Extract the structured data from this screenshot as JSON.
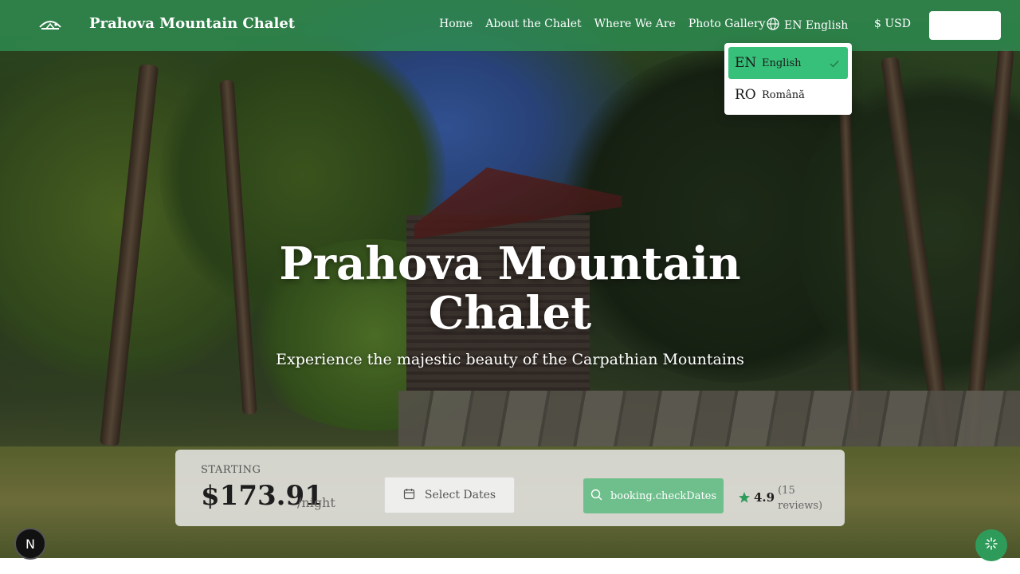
{
  "navbar": {
    "brand": "Prahova Mountain Chalet",
    "links": [
      "Home",
      "About the Chalet",
      "Where We Are",
      "Photo Gallery"
    ],
    "language_button": "EN English",
    "currency_button": "$ USD",
    "background_color": "#2e8c52"
  },
  "language_menu": {
    "items": [
      {
        "code": "EN",
        "name": "English",
        "selected": true
      },
      {
        "code": "RO",
        "name": "Română",
        "selected": false
      }
    ],
    "active_color": "#37c07a"
  },
  "hero": {
    "title": "Prahova Mountain Chalet",
    "subtitle": "Experience the majestic beauty of the Carpathian Mountains"
  },
  "booking": {
    "starting_label": "STARTING",
    "price": "$173.91",
    "per_night": "/night",
    "dates_placeholder": "Select Dates",
    "check_button": "booking.checkDates",
    "rating": "4.9",
    "reviews": "(15 reviews)",
    "accent_color": "#2f9b5a"
  },
  "floating": {
    "dev_badge": "N"
  }
}
